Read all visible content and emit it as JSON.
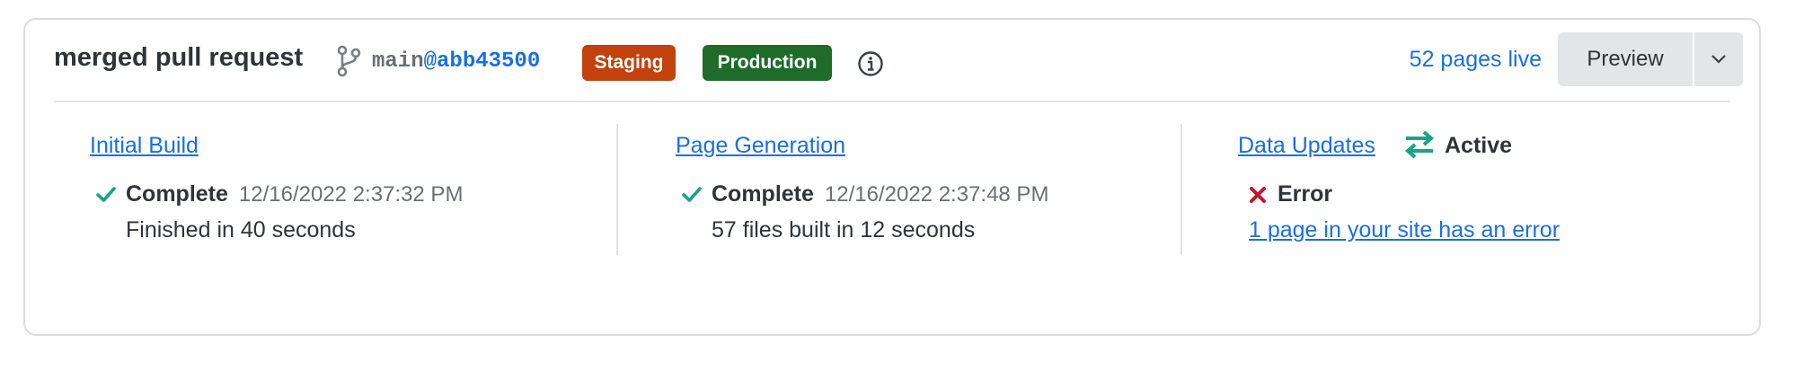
{
  "header": {
    "title": "merged pull request",
    "branch_icon": "git-branch-icon",
    "branch_name": "main",
    "commit_ref": "@abb43500",
    "badges": [
      {
        "label": "Staging",
        "color": "#c2410c"
      },
      {
        "label": "Production",
        "color": "#1e6b2a"
      }
    ],
    "info_icon": "info-circle-icon",
    "pages_live": "52 pages live",
    "preview_label": "Preview",
    "dropdown_icon": "chevron-down-icon"
  },
  "columns": [
    {
      "link": "Initial Build",
      "status_icon": "check-icon",
      "status": "Complete",
      "timestamp": "12/16/2022  2:37:32 PM",
      "detail": "Finished in 40 seconds"
    },
    {
      "link": "Page Generation",
      "status_icon": "check-icon",
      "status": "Complete",
      "timestamp": "12/16/2022  2:37:48 PM",
      "detail": "57 files built in 12 seconds"
    },
    {
      "link": "Data Updates",
      "state_icon": "sync-arrows-icon",
      "state": "Active",
      "status_icon": "x-icon",
      "status": "Error",
      "error_link": "1 page in your site has an error"
    }
  ],
  "colors": {
    "accent_link": "#1a6fe0",
    "success": "#17a589",
    "error": "#c0172b",
    "staging": "#c2410c",
    "production": "#1e6b2a"
  }
}
